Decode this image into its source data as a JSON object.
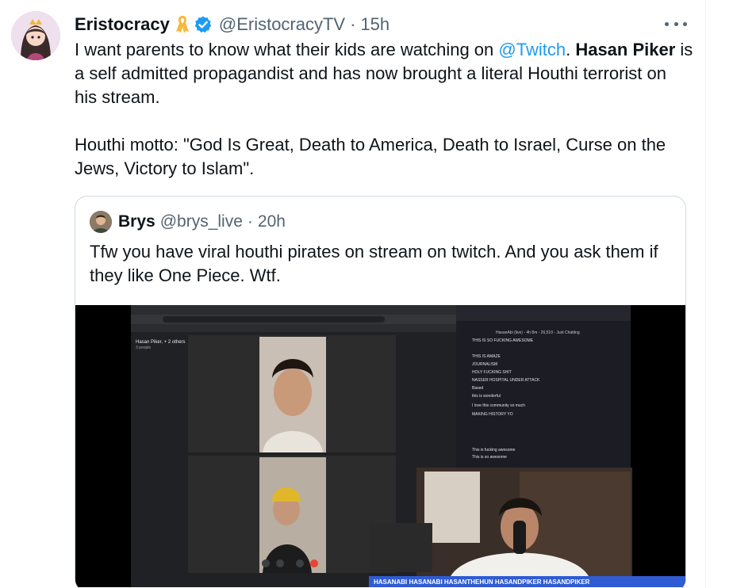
{
  "tweet": {
    "author": {
      "display_name": "Eristocracy",
      "handle": "@EristocracyTV",
      "time": "15h",
      "badges": [
        "ribbon-icon",
        "verified-icon"
      ]
    },
    "text": {
      "line1_pre": "I want parents to know what their kids are watching on ",
      "mention": "@Twitch",
      "line1_post": ". ",
      "bold_name": "Hasan Piker",
      "line1_rest": " is a self admitted propagandist and has now brought a literal Houthi terrorist on his stream.",
      "paragraph2": "Houthi motto: \"God Is Great, Death to America, Death to Israel, Curse on the Jews, Victory to Islam\"."
    },
    "more_icon": "more-icon"
  },
  "quote": {
    "author": {
      "display_name": "Brys",
      "handle": "@brys_live",
      "time": "20h"
    },
    "text": "Tfw you have viral houthi pirates on stream on twitch. And you ask them if they like One Piece. Wtf.",
    "media": {
      "call_title": "Hasan Piker, + 2 others",
      "call_subtitle": "3 people",
      "chat_header": "HasanAbi (live) - 4h 8m - 26,510 - Just Chatting",
      "chat_lines": [
        "THIS IS SO FUCKING AWESOME",
        "THIS IS AMAZE",
        "JOURNALISM",
        "HOLY FUCKING SHIT",
        "NASSER HOSPITAL UNDER ATTACK",
        "Based",
        "this is wonderful",
        "I love this community so much",
        "MAKING HISTORY YO",
        "This is fucking awesome",
        "This is so awesome"
      ],
      "overlay_bar": "HASANABI  HASANABI  HASANTHEHUN  HASANDPIKER  HASANDPIKER",
      "overlay_bar_color": "#2f5bd3",
      "chat_bg": "#1c1c24"
    }
  },
  "colors": {
    "link": "#1d9bf0",
    "secondary_text": "#536471",
    "verified": "#1d9bf0",
    "ribbon": "#f6b93b",
    "border": "#cfd9de"
  }
}
